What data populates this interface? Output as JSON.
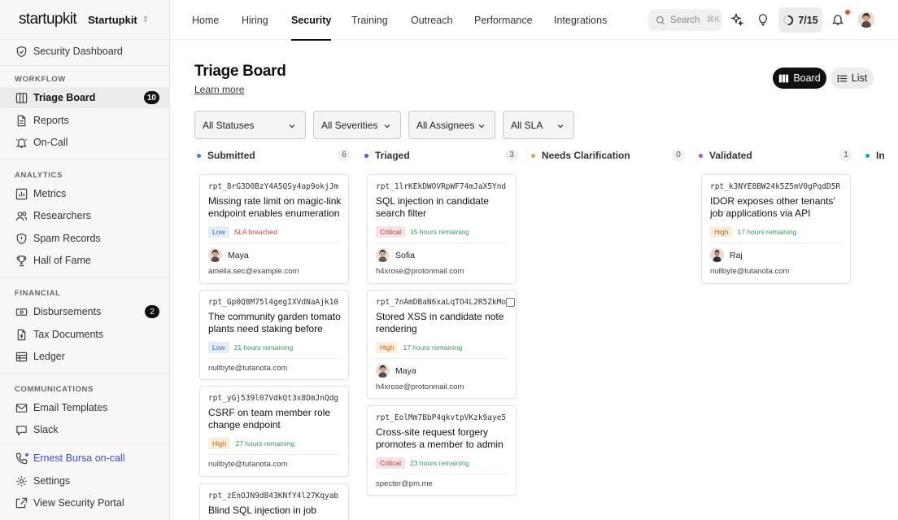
{
  "brand": {
    "logo": "startupkit",
    "org": "Startupkit"
  },
  "sidebar": {
    "top_item": {
      "label": "Security Dashboard"
    },
    "sections": [
      {
        "title": "WORKFLOW",
        "items": [
          {
            "label": "Triage Board",
            "badge": "10",
            "active": true
          },
          {
            "label": "Reports"
          },
          {
            "label": "On-Call"
          }
        ]
      },
      {
        "title": "ANALYTICS",
        "items": [
          {
            "label": "Metrics"
          },
          {
            "label": "Researchers"
          },
          {
            "label": "Spam Records"
          },
          {
            "label": "Hall of Fame"
          }
        ]
      },
      {
        "title": "FINANCIAL",
        "items": [
          {
            "label": "Disbursements",
            "badge": "2"
          },
          {
            "label": "Tax Documents"
          },
          {
            "label": "Ledger"
          }
        ]
      },
      {
        "title": "COMMUNICATIONS",
        "items": [
          {
            "label": "Email Templates"
          },
          {
            "label": "Slack"
          }
        ]
      }
    ],
    "footer": [
      {
        "label": "Ernest Bursa on-call"
      },
      {
        "label": "Settings"
      },
      {
        "label": "View Security Portal"
      }
    ]
  },
  "topnav": {
    "tabs": [
      "Home",
      "Hiring",
      "Security",
      "Training",
      "Outreach",
      "Performance",
      "Integrations"
    ],
    "active_tab": "Security",
    "search": {
      "placeholder": "Search",
      "shortcut": "⌘K"
    },
    "progress": "7/15"
  },
  "page": {
    "title": "Triage Board",
    "learn_more": "Learn more",
    "view_board": "Board",
    "view_list": "List"
  },
  "filters": [
    "All Statuses",
    "All Severities",
    "All Assignees",
    "All SLA"
  ],
  "columns": [
    {
      "name": "Submitted",
      "count": "6",
      "color": "#4a7bd0"
    },
    {
      "name": "Triaged",
      "count": "3",
      "color": "#4a5fd8"
    },
    {
      "name": "Needs Clarification",
      "count": "0",
      "color": "#e0a452"
    },
    {
      "name": "Validated",
      "count": "1",
      "color": "#9a55d6"
    },
    {
      "name": "In",
      "count": "",
      "color": "#19a8b8"
    }
  ],
  "severity_colors": {
    "Low": {
      "bg": "#e3edf9",
      "fg": "#3a67a8"
    },
    "High": {
      "bg": "#fdeedc",
      "fg": "#b5651d"
    },
    "Critical": {
      "bg": "#fbe2e2",
      "fg": "#b53a3a"
    }
  },
  "sla_colors": {
    "breached": "#d64545",
    "ok": "#3a9a5b"
  },
  "cards": {
    "submitted": [
      {
        "id": "rpt_8rG3D0BzY4A5QSy4ap9okjJm",
        "title": "Missing rate limit on magic-link endpoint enables enumeration",
        "severity": "Low",
        "sla": "SLA breached",
        "assignee": "Maya",
        "email": "amelia.sec@example.com"
      },
      {
        "id": "rpt_Gp0Q8M75l4gegIXVdNaAjk10",
        "title": "The community garden tomato plants need staking before th…",
        "severity": "Low",
        "sla": "21 hours remaining",
        "assignee": "",
        "email": "nullbyte@tutanota.com"
      },
      {
        "id": "rpt_yGj539l07VdkQt3x8DmJnQdg",
        "title": "CSRF on team member role change endpoint",
        "severity": "High",
        "sla": "27 hours remaining",
        "assignee": "",
        "email": "nullbyte@tutanota.com"
      },
      {
        "id": "rpt_zEnOJN9dB43KNfY4l27Kqyab",
        "title": "Blind SQL injection in job",
        "severity": "",
        "sla": "",
        "assignee": "",
        "email": ""
      }
    ],
    "triaged": [
      {
        "id": "rpt_1lrKEkDWOVRpWF74mJaX5Ynd",
        "title": "SQL injection in candidate search filter",
        "severity": "Critical",
        "sla": "15 hours remaining",
        "assignee": "Sofia",
        "email": "h4xrose@protonmail.com"
      },
      {
        "id": "rpt_7nAmDBaN6xaLqTO4L2R5ZkMo",
        "title": "Stored XSS in candidate note rendering",
        "severity": "High",
        "sla": "17 hours remaining",
        "assignee": "Maya",
        "email": "h4xrose@protonmail.com"
      },
      {
        "id": "rpt_EolMm7BbP4qkvtpVKzk9aye5",
        "title": "Cross-site request forgery promotes a member to admin",
        "severity": "Critical",
        "sla": "23 hours remaining",
        "assignee": "",
        "email": "specter@pm.me"
      }
    ],
    "validated": [
      {
        "id": "rpt_k3NYE8BW24k5Z5mV0gPqdD5R",
        "title": "IDOR exposes other tenants' job applications via API",
        "severity": "High",
        "sla": "17 hours remaining",
        "assignee": "Raj",
        "email": "nullbyte@tutanota.com"
      }
    ]
  }
}
